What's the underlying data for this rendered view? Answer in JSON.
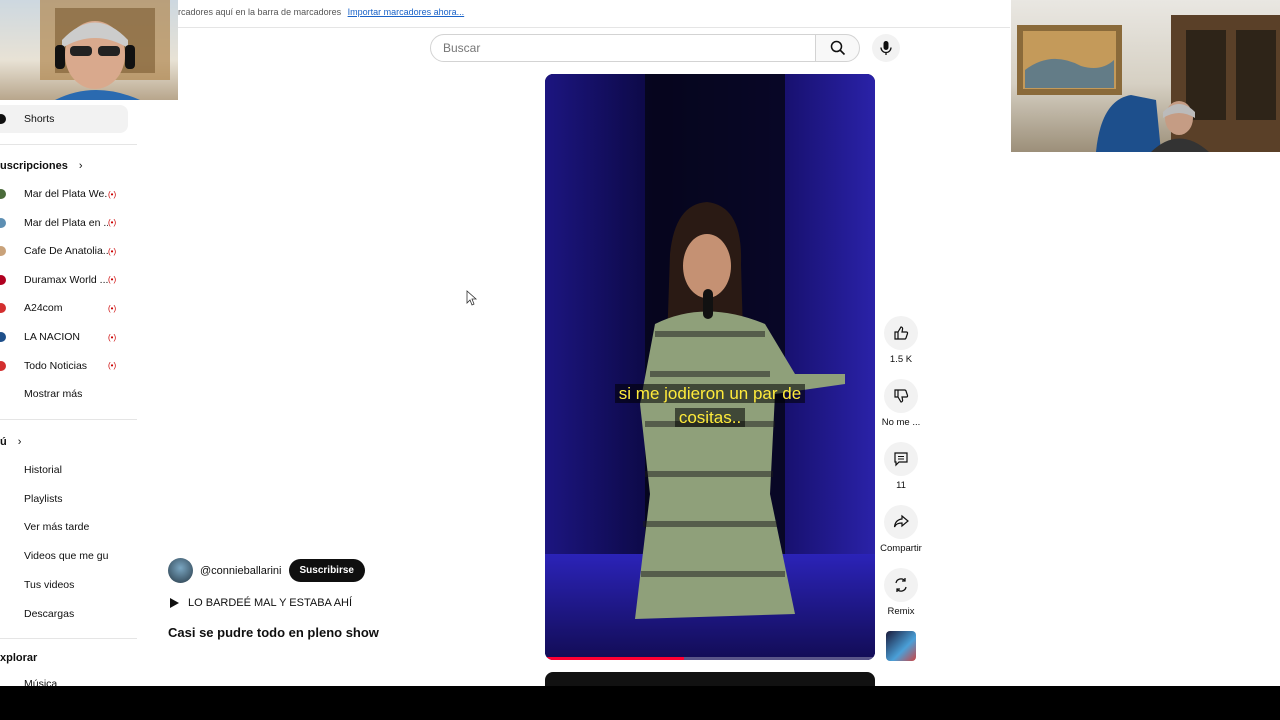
{
  "bookmarks_bar": {
    "text": "rcadores aquí en la barra de marcadores",
    "import_link": "Importar marcadores ahora..."
  },
  "search": {
    "placeholder": "Buscar"
  },
  "sidebar": {
    "shorts_label": "Shorts",
    "subscriptions_heading": "uscripciones",
    "subscriptions": [
      {
        "label": "Mar del Plata We...",
        "live": true,
        "color": "#4a6b3a"
      },
      {
        "label": "Mar del Plata en ...",
        "live": true,
        "color": "#5d8fb3"
      },
      {
        "label": "Cafe De Anatolia...",
        "live": true,
        "color": "#c9a27a"
      },
      {
        "label": "Duramax World ...",
        "live": true,
        "color": "#b00020"
      },
      {
        "label": "A24com",
        "live": true,
        "color": "#d32f2f"
      },
      {
        "label": "LA NACION",
        "live": true,
        "color": "#1e4f8a"
      },
      {
        "label": "Todo Noticias",
        "live": true,
        "color": "#d32f2f"
      },
      {
        "label": "Mostrar más",
        "live": false,
        "color": "#ffffff"
      }
    ],
    "you_heading": "ú",
    "you_items": [
      {
        "label": "Historial"
      },
      {
        "label": "Playlists"
      },
      {
        "label": "Ver más tarde"
      },
      {
        "label": "Videos que me gus..."
      },
      {
        "label": "Tus videos"
      },
      {
        "label": "Descargas"
      }
    ],
    "explore_heading": "xplorar",
    "explore_items": [
      {
        "label": "Música"
      }
    ]
  },
  "short": {
    "caption_line1": "si me jodieron un par de",
    "caption_line2": "cositas..",
    "progress": 0.42
  },
  "actions": {
    "likes": "1.5 K",
    "dislike_label": "No me ...",
    "comments": "11",
    "share_label": "Compartir",
    "remix_label": "Remix"
  },
  "channel": {
    "handle": "@connieballarini",
    "subscribe_label": "Suscribirse",
    "music_label": "LO BARDEÉ MAL Y ESTABA AHÍ",
    "title": "Casi se pudre todo en pleno show"
  },
  "colors": {
    "accent_red": "#ff0033",
    "live_red": "#cc0000",
    "caption_yellow": "#ffeb3b"
  }
}
